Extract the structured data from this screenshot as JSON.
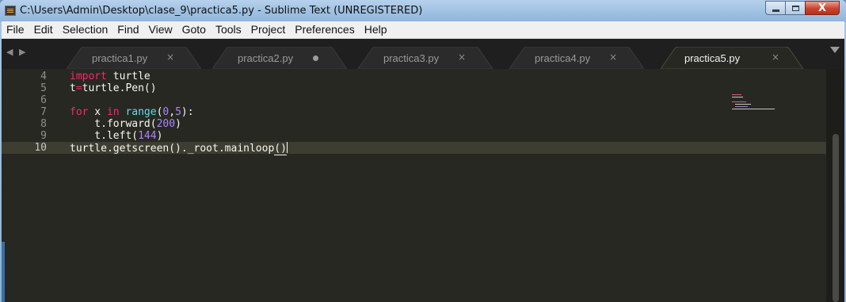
{
  "window": {
    "title": "C:\\Users\\Admin\\Desktop\\clase_9\\practica5.py - Sublime Text (UNREGISTERED)",
    "close_glyph": "X"
  },
  "menu": [
    "File",
    "Edit",
    "Selection",
    "Find",
    "View",
    "Goto",
    "Tools",
    "Project",
    "Preferences",
    "Help"
  ],
  "tabs": {
    "nav_arrows": "◀ ▶",
    "items": [
      {
        "label": "practica1.py",
        "state": "close",
        "glyph": "×"
      },
      {
        "label": "practica2.py",
        "state": "dirty",
        "glyph": ""
      },
      {
        "label": "practica3.py",
        "state": "close",
        "glyph": "×"
      },
      {
        "label": "practica4.py",
        "state": "close",
        "glyph": "×"
      },
      {
        "label": "practica5.py",
        "state": "active",
        "glyph": "×"
      }
    ]
  },
  "editor": {
    "line_numbers": [
      "4",
      "5",
      "6",
      "7",
      "8",
      "9",
      "10"
    ],
    "current_line": "10",
    "code": {
      "l4_kw": "import",
      "l4_rest": " turtle",
      "l5_a": "t",
      "l5_op": "=",
      "l5_b": "turtle.Pen()",
      "l7_kw": "for",
      "l7_a": " x ",
      "l7_in": "in",
      "l7_b": " ",
      "l7_fn": "range",
      "l7_c": "(",
      "l7_n1": "0",
      "l7_d": ",",
      "l7_n2": "5",
      "l7_e": "):",
      "l8_a": "    t.forward(",
      "l8_n": "200",
      "l8_b": ")",
      "l9_a": "    t.left(",
      "l9_n": "144",
      "l9_b": ")",
      "l10_a": "turtle.getscreen()._root.mainloop",
      "l10_b": "()"
    }
  },
  "colors": {
    "editor_bg": "#272822",
    "keyword": "#f92672",
    "number": "#ae81ff",
    "builtin": "#66d9ef",
    "text": "#f8f8f2"
  }
}
